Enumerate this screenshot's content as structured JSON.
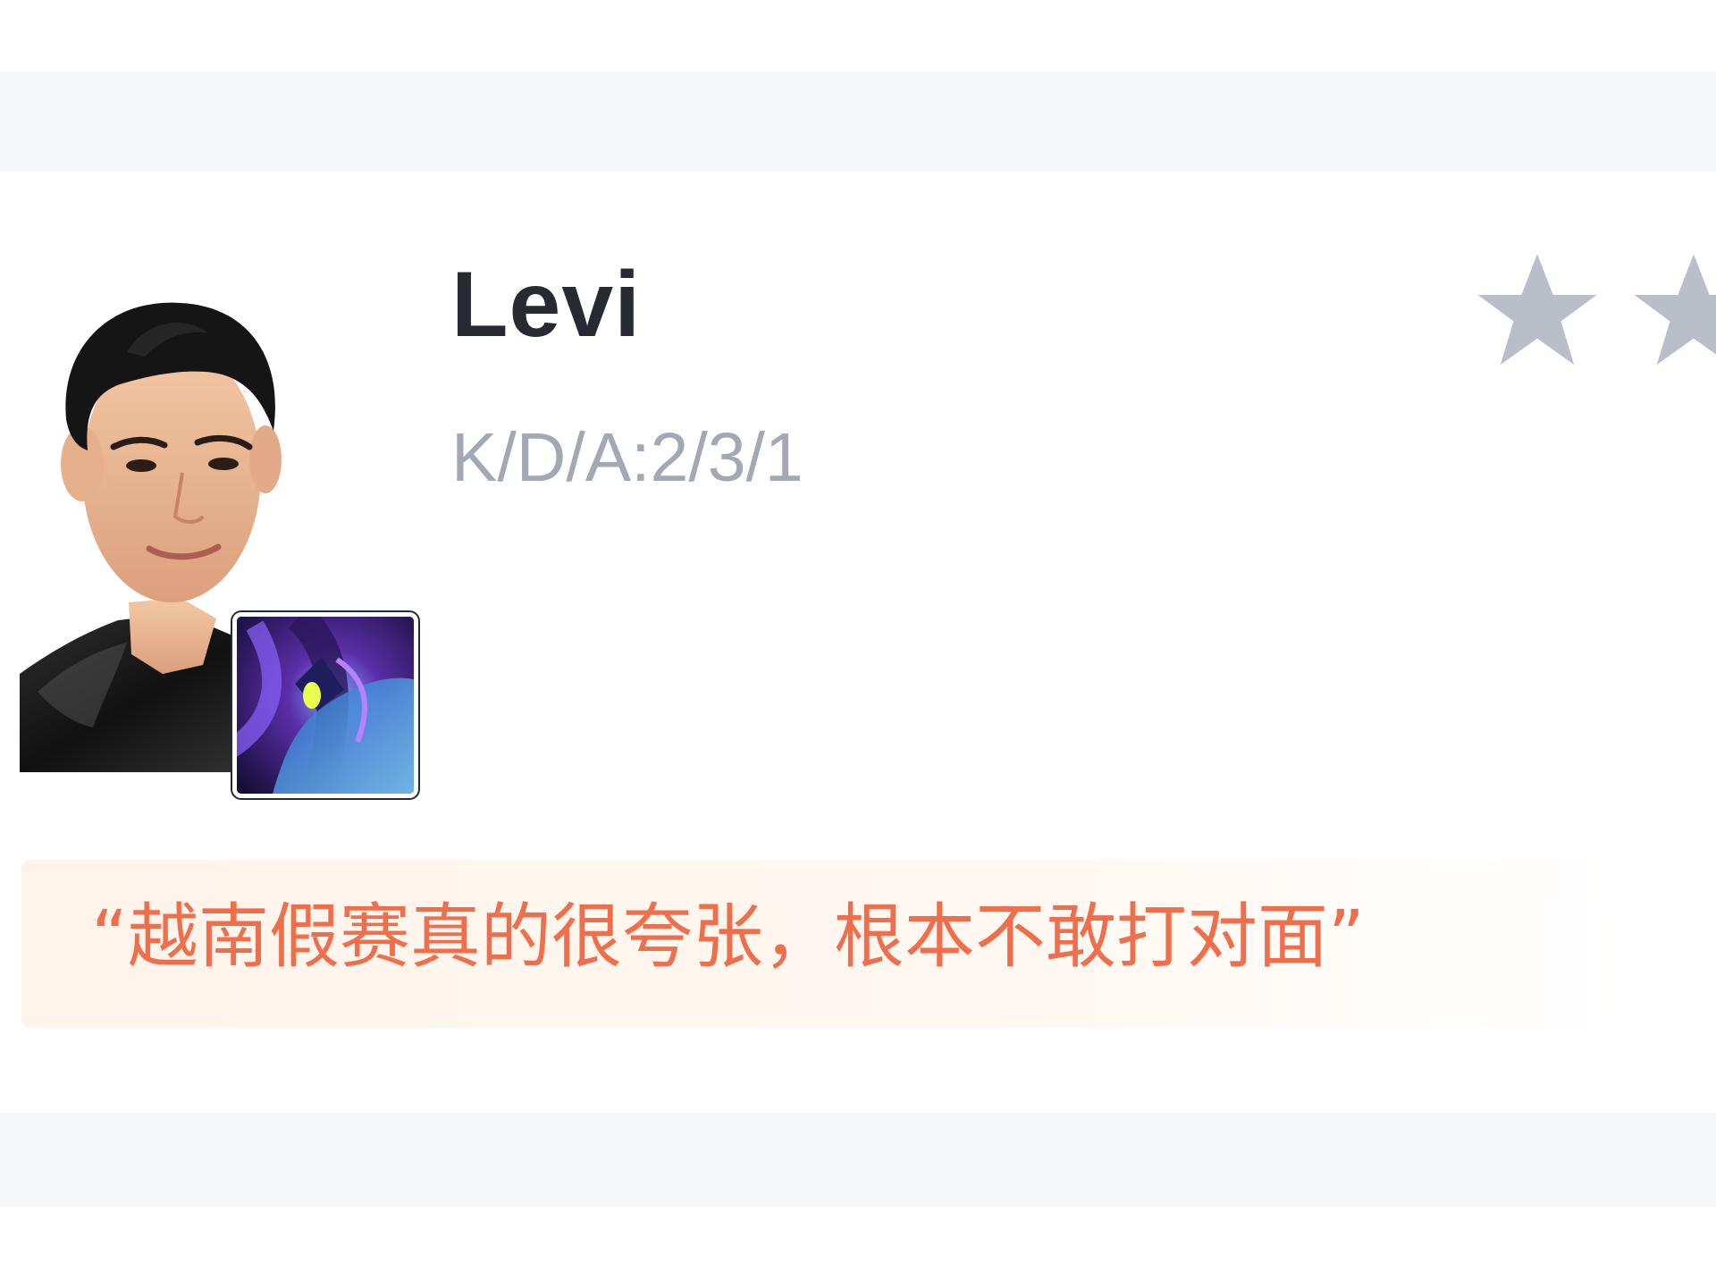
{
  "player": {
    "name": "Levi",
    "kda": "K/D/A:2/3/1"
  },
  "rating": {
    "stars_visible": 2
  },
  "quote": {
    "text": "“越南假赛真的很夸张，根本不敢打对面”"
  },
  "colors": {
    "name": "#272a31",
    "kda": "#a3a9b4",
    "quote_text": "#ef6f4d",
    "quote_bg": "#fff4ea",
    "star": "#b9bec9",
    "section_gap": "#f5f6f8"
  },
  "icons": {
    "avatar": "player-avatar",
    "champion": "champion-icon",
    "star": "star-icon"
  }
}
